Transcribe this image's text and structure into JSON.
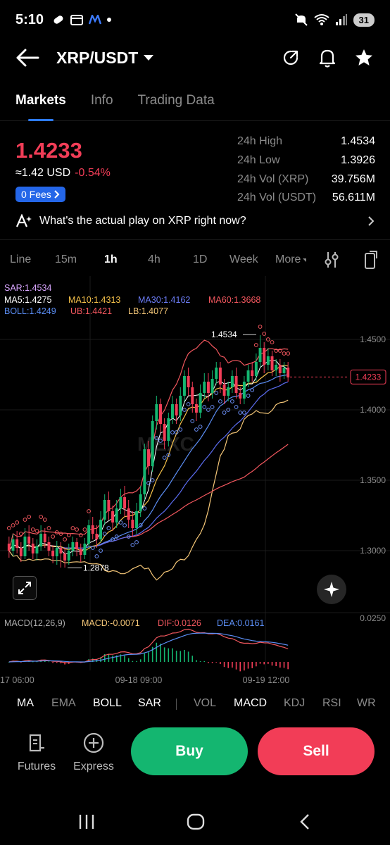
{
  "status": {
    "time": "5:10",
    "battery": "31"
  },
  "header": {
    "pair": "XRP/USDT"
  },
  "tabs": [
    {
      "label": "Markets",
      "active": true
    },
    {
      "label": "Info",
      "active": false
    },
    {
      "label": "Trading Data",
      "active": false
    }
  ],
  "ticker": {
    "price": "1.4233",
    "usd": "≈1.42 USD",
    "change": "-0.54%",
    "fees": "0 Fees",
    "stats": [
      {
        "label": "24h High",
        "value": "1.4534"
      },
      {
        "label": "24h Low",
        "value": "1.3926"
      },
      {
        "label": "24h Vol (XRP)",
        "value": "39.756M"
      },
      {
        "label": "24h Vol (USDT)",
        "value": "56.611M"
      }
    ]
  },
  "ai_prompt": "What's the actual play on XRP right now?",
  "timeframes": [
    {
      "label": "Line",
      "active": false
    },
    {
      "label": "15m",
      "active": false
    },
    {
      "label": "1h",
      "active": true
    },
    {
      "label": "4h",
      "active": false
    },
    {
      "label": "1D",
      "active": false
    },
    {
      "label": "Week",
      "active": false
    },
    {
      "label": "More",
      "active": false
    }
  ],
  "indicator_readout": {
    "sar": "SAR:1.4534",
    "ma5": "MA5:1.4275",
    "ma10": "MA10:1.4313",
    "ma30": "MA30:1.4162",
    "ma60": "MA60:1.3668",
    "boll": "BOLL:1.4249",
    "ub": "UB:1.4421",
    "lb": "LB:1.4077",
    "macd_title": "MACD(12,26,9)",
    "macd": "MACD:-0.0071",
    "dif": "DIF:0.0126",
    "dea": "DEA:0.0161"
  },
  "chart_data": {
    "type": "candlestick",
    "y_ticks": [
      "1.4500",
      "1.4000",
      "1.3500",
      "1.3000"
    ],
    "macd_tick": "0.0250",
    "x_ticks": [
      "17 06:00",
      "09-18 09:00",
      "09-19 12:00"
    ],
    "current_price": "1.4233",
    "high_marker": "1.4534",
    "low_marker": "1.2878",
    "watermark": "MEXC",
    "colors": {
      "up": "#14b670",
      "down": "#f23d57",
      "ma5": "#ffffff",
      "ma10": "#f5c14a",
      "ma30": "#5b6cf0",
      "ma60": "#f2575e",
      "sar": "#6b8ef5",
      "boll": "#5b8ef5",
      "ub": "#f2575e",
      "lb": "#f5c778"
    },
    "candles": [
      [
        1.305,
        1.3,
        1.31,
        1.295
      ],
      [
        1.3,
        1.308,
        1.312,
        1.296
      ],
      [
        1.308,
        1.302,
        1.314,
        1.298
      ],
      [
        1.302,
        1.296,
        1.306,
        1.292
      ],
      [
        1.296,
        1.31,
        1.316,
        1.294
      ],
      [
        1.31,
        1.305,
        1.318,
        1.3
      ],
      [
        1.305,
        1.298,
        1.309,
        1.294
      ],
      [
        1.298,
        1.303,
        1.308,
        1.293
      ],
      [
        1.303,
        1.312,
        1.318,
        1.3
      ],
      [
        1.312,
        1.306,
        1.316,
        1.302
      ],
      [
        1.306,
        1.3,
        1.31,
        1.296
      ],
      [
        1.3,
        1.296,
        1.304,
        1.291
      ],
      [
        1.296,
        1.302,
        1.307,
        1.29
      ],
      [
        1.302,
        1.298,
        1.306,
        1.288
      ],
      [
        1.298,
        1.293,
        1.302,
        1.288
      ],
      [
        1.293,
        1.3,
        1.305,
        1.29
      ],
      [
        1.3,
        1.306,
        1.31,
        1.296
      ],
      [
        1.306,
        1.301,
        1.309,
        1.296
      ],
      [
        1.301,
        1.297,
        1.305,
        1.292
      ],
      [
        1.297,
        1.305,
        1.309,
        1.294
      ],
      [
        1.305,
        1.318,
        1.322,
        1.302
      ],
      [
        1.318,
        1.312,
        1.324,
        1.308
      ],
      [
        1.312,
        1.308,
        1.318,
        1.302
      ],
      [
        1.308,
        1.322,
        1.328,
        1.306
      ],
      [
        1.322,
        1.336,
        1.34,
        1.318
      ],
      [
        1.336,
        1.328,
        1.342,
        1.322
      ],
      [
        1.328,
        1.32,
        1.332,
        1.314
      ],
      [
        1.32,
        1.33,
        1.336,
        1.316
      ],
      [
        1.33,
        1.338,
        1.344,
        1.326
      ],
      [
        1.338,
        1.33,
        1.346,
        1.324
      ],
      [
        1.33,
        1.322,
        1.336,
        1.316
      ],
      [
        1.322,
        1.316,
        1.328,
        1.31
      ],
      [
        1.316,
        1.328,
        1.334,
        1.312
      ],
      [
        1.328,
        1.34,
        1.346,
        1.324
      ],
      [
        1.34,
        1.372,
        1.376,
        1.336
      ],
      [
        1.372,
        1.36,
        1.378,
        1.354
      ],
      [
        1.36,
        1.392,
        1.396,
        1.356
      ],
      [
        1.392,
        1.404,
        1.41,
        1.386
      ],
      [
        1.404,
        1.39,
        1.408,
        1.384
      ],
      [
        1.39,
        1.378,
        1.394,
        1.372
      ],
      [
        1.378,
        1.394,
        1.398,
        1.374
      ],
      [
        1.394,
        1.404,
        1.41,
        1.39
      ],
      [
        1.404,
        1.396,
        1.408,
        1.39
      ],
      [
        1.396,
        1.41,
        1.416,
        1.392
      ],
      [
        1.41,
        1.424,
        1.428,
        1.406
      ],
      [
        1.424,
        1.416,
        1.43,
        1.41
      ],
      [
        1.416,
        1.404,
        1.42,
        1.398
      ],
      [
        1.404,
        1.398,
        1.408,
        1.392
      ],
      [
        1.398,
        1.412,
        1.418,
        1.394
      ],
      [
        1.412,
        1.42,
        1.426,
        1.408
      ],
      [
        1.42,
        1.412,
        1.426,
        1.406
      ],
      [
        1.412,
        1.422,
        1.428,
        1.408
      ],
      [
        1.422,
        1.43,
        1.434,
        1.418
      ],
      [
        1.43,
        1.418,
        1.434,
        1.412
      ],
      [
        1.418,
        1.41,
        1.422,
        1.404
      ],
      [
        1.41,
        1.416,
        1.42,
        1.406
      ],
      [
        1.416,
        1.424,
        1.428,
        1.412
      ],
      [
        1.424,
        1.412,
        1.43,
        1.408
      ],
      [
        1.412,
        1.408,
        1.416,
        1.404
      ],
      [
        1.408,
        1.42,
        1.424,
        1.404
      ],
      [
        1.42,
        1.428,
        1.432,
        1.416
      ],
      [
        1.428,
        1.424,
        1.434,
        1.42
      ],
      [
        1.424,
        1.434,
        1.44,
        1.42
      ],
      [
        1.434,
        1.444,
        1.453,
        1.43
      ],
      [
        1.444,
        1.432,
        1.448,
        1.426
      ],
      [
        1.432,
        1.438,
        1.444,
        1.428
      ],
      [
        1.438,
        1.428,
        1.442,
        1.424
      ],
      [
        1.428,
        1.432,
        1.436,
        1.424
      ],
      [
        1.432,
        1.426,
        1.436,
        1.42
      ],
      [
        1.426,
        1.43,
        1.434,
        1.422
      ],
      [
        1.43,
        1.423,
        1.434,
        1.42
      ]
    ]
  },
  "indicator_tabs": [
    {
      "label": "MA",
      "on": true
    },
    {
      "label": "EMA",
      "on": false
    },
    {
      "label": "BOLL",
      "on": true
    },
    {
      "label": "SAR",
      "on": true
    },
    {
      "label": "VOL",
      "on": false
    },
    {
      "label": "MACD",
      "on": true
    },
    {
      "label": "KDJ",
      "on": false
    },
    {
      "label": "RSI",
      "on": false
    },
    {
      "label": "WR",
      "on": false
    }
  ],
  "actions": {
    "futures": "Futures",
    "express": "Express",
    "buy": "Buy",
    "sell": "Sell"
  }
}
